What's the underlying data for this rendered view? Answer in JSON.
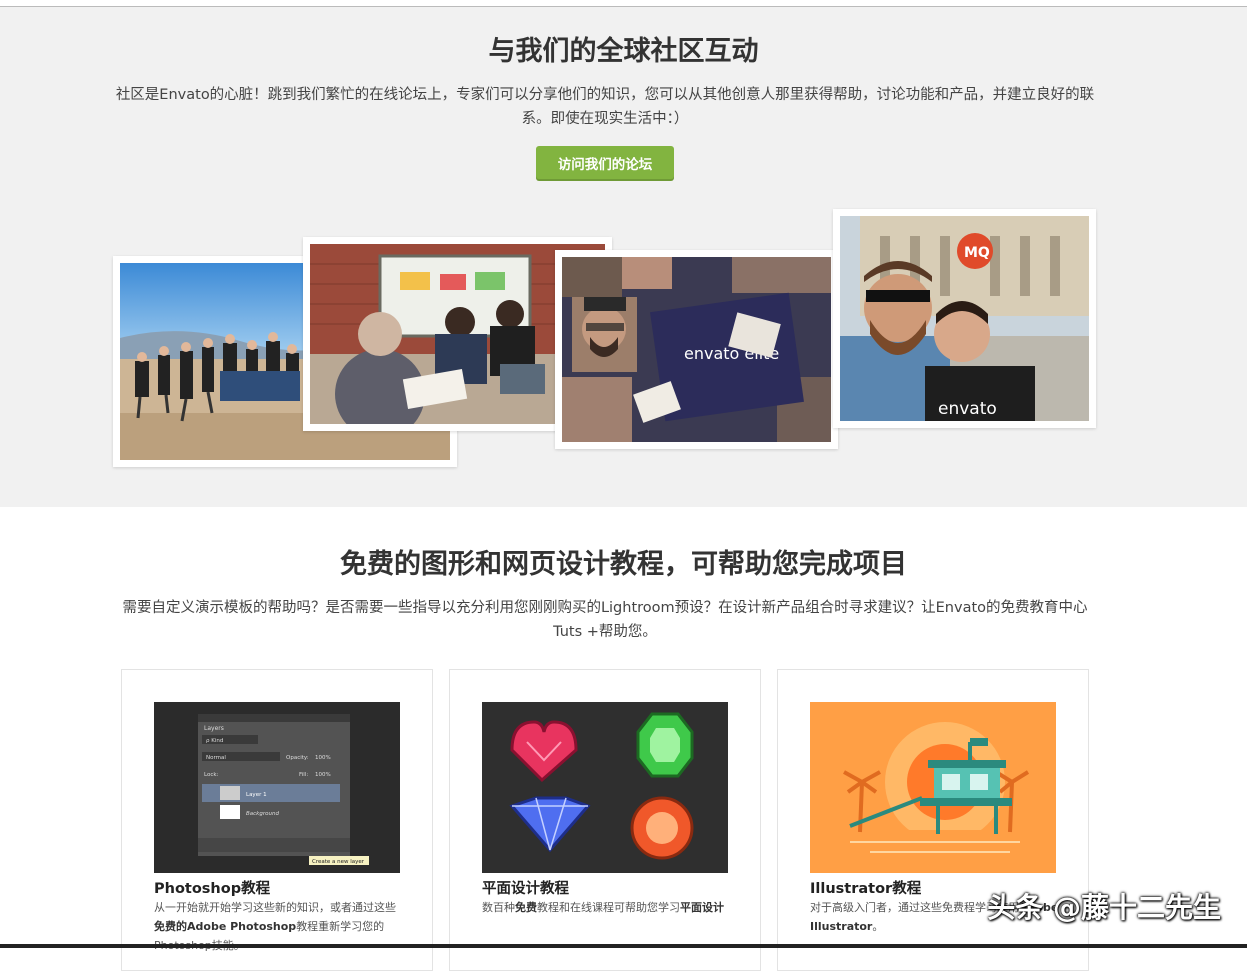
{
  "community": {
    "title": "与我们的全球社区互动",
    "description": "社区是Envato的心脏！跳到我们繁忙的在线论坛上，专家们可以分享他们的知识，您可以从其他创意人那里获得帮助，讨论功能和产品，并建立良好的联系。即使在现实生活中：）",
    "button_label": "访问我们的论坛",
    "photos": [
      {
        "name": "beach-group-photo"
      },
      {
        "name": "meeting-room-photo"
      },
      {
        "name": "envato-elite-collage-photo",
        "overlay_text": "envato elite"
      },
      {
        "name": "selfie-photo",
        "overlay_text": "envato",
        "sign_text": "MQ"
      }
    ]
  },
  "tutorials": {
    "title": "免费的图形和网页设计教程，可帮助您完成项目",
    "description": "需要自定义演示模板的帮助吗？是否需要一些指导以充分利用您刚刚购买的Lightroom预设？在设计新产品组合时寻求建议？让Envato的免费教育中心Tuts +帮助您。",
    "cards": [
      {
        "title": "Photoshop教程",
        "text_before": "从一开始就开始学习这些新的知识，或者通过这些",
        "text_bold": "免费的Adobe Photoshop",
        "text_after": "教程重新学习您的Photoshop技能。",
        "panel": {
          "tab": "Layers",
          "kind": "ρ Kind",
          "mode": "Normal",
          "opacity_label": "Opacity:",
          "opacity_value": "100%",
          "lock_label": "Lock:",
          "fill_label": "Fill:",
          "fill_value": "100%",
          "layer1": "Layer 1",
          "layer2": "Background",
          "tooltip": "Create a new layer"
        }
      },
      {
        "title": "平面设计教程",
        "text_before": "数百种",
        "text_bold": "免费",
        "text_after": "教程和在线课程可帮助您学习",
        "text_bold2": "平面设计"
      },
      {
        "title": "Illustrator教程",
        "text_before": "对于高级入门者，通过这些免费",
        "text_after": "程学习使用",
        "text_bold": "Adobe Illustrator",
        "text_end": "。"
      }
    ]
  },
  "watermark": "头条 @藤十二先生",
  "colors": {
    "accent_green": "#82b440",
    "section_bg": "#f1f1f1"
  }
}
